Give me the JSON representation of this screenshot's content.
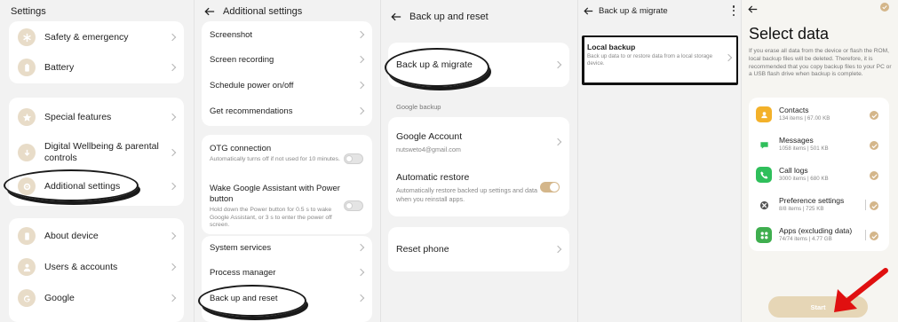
{
  "panel1": {
    "title": "Settings",
    "group1": [
      {
        "label": "Safety & emergency",
        "icon": "asterisk-icon"
      },
      {
        "label": "Battery",
        "icon": "battery-icon"
      }
    ],
    "group2": [
      {
        "label": "Special features",
        "icon": "star-icon"
      },
      {
        "label": "Digital Wellbeing & parental controls",
        "icon": "wellbeing-icon"
      },
      {
        "label": "Additional settings",
        "icon": "gear-icon"
      }
    ],
    "group3": [
      {
        "label": "About device",
        "icon": "phone-icon"
      },
      {
        "label": "Users & accounts",
        "icon": "person-icon"
      },
      {
        "label": "Google",
        "icon": "google-icon"
      }
    ]
  },
  "panel2": {
    "title": "Additional settings",
    "group1": [
      "Screenshot",
      "Screen recording",
      "Schedule power on/off",
      "Get recommendations"
    ],
    "otg_label": "OTG connection",
    "otg_desc": "Automatically turns off if not used for 10 minutes.",
    "wake_label": "Wake Google Assistant with Power button",
    "wake_desc": "Hold down the Power button for 0.5 s to wake Google Assistant, or 3 s to enter the power off screen.",
    "group3": [
      "System services",
      "Process manager",
      "Back up and reset"
    ]
  },
  "panel3": {
    "title": "Back up and reset",
    "migrate_label": "Back up & migrate",
    "google_backup_head": "Google backup",
    "account_label": "Google Account",
    "account_value": "nutsweto4@gmail.com",
    "restore_label": "Automatic restore",
    "restore_desc": "Automatically restore backed up settings and data when you reinstall apps.",
    "reset_label": "Reset phone"
  },
  "panel4": {
    "title": "Back up & migrate",
    "local_label": "Local backup",
    "local_desc": "Back up data to or restore data from a local storage device."
  },
  "panel5": {
    "title": "Select data",
    "desc": "If you erase all data from the device or flash the ROM, local backup files will be deleted. Therefore, it is recommended that you copy backup files to your PC or a USB flash drive when backup is complete.",
    "items": [
      {
        "name": "Contacts",
        "detail": "134 items | 67.00 KB",
        "icon": "contacts-icon",
        "color": "#f3b12a"
      },
      {
        "name": "Messages",
        "detail": "1058 items | 501 KB",
        "icon": "messages-icon",
        "color": "#ffffff"
      },
      {
        "name": "Call logs",
        "detail": "3000 items | 680 KB",
        "icon": "call-icon",
        "color": "#2fbf5b"
      },
      {
        "name": "Preference settings",
        "detail": "8/8 items | 725 KB",
        "icon": "preferences-icon",
        "color": "#ffffff"
      },
      {
        "name": "Apps (excluding data)",
        "detail": "74/74 items | 4.77 GB",
        "icon": "apps-icon",
        "color": "#3fae4f"
      }
    ],
    "start_label": "Start"
  },
  "colors": {
    "accent": "#d4b68a",
    "arrow": "#e01010"
  }
}
